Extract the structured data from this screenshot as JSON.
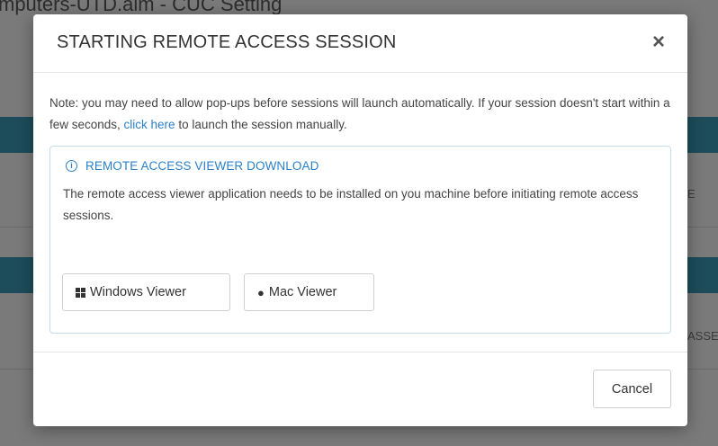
{
  "background": {
    "page_title": "mputers-UTD.aim - CUC Setting",
    "row_fragment_1": "E",
    "row_fragment_2": "ASSE"
  },
  "modal": {
    "title": "STARTING REMOTE ACCESS SESSION",
    "close_label": "×",
    "note_before_link": "Note: you may need to allow pop-ups before sessions will launch automatically. If your session doesn't start within a few seconds, ",
    "note_link": "click here",
    "note_after_link": " to launch the session manually.",
    "info": {
      "icon": "info-circle-icon",
      "heading": "REMOTE ACCESS VIEWER DOWNLOAD",
      "text": "The remote access viewer application needs to be installed on you machine before initiating remote access sessions."
    },
    "buttons": {
      "windows_label": "Windows Viewer",
      "windows_icon": "windows-icon",
      "mac_label": "Mac Viewer",
      "mac_icon": "apple-icon"
    },
    "footer": {
      "cancel_label": "Cancel"
    }
  },
  "colors": {
    "accent": "#2c80c8",
    "band": "#1d4d5a"
  }
}
